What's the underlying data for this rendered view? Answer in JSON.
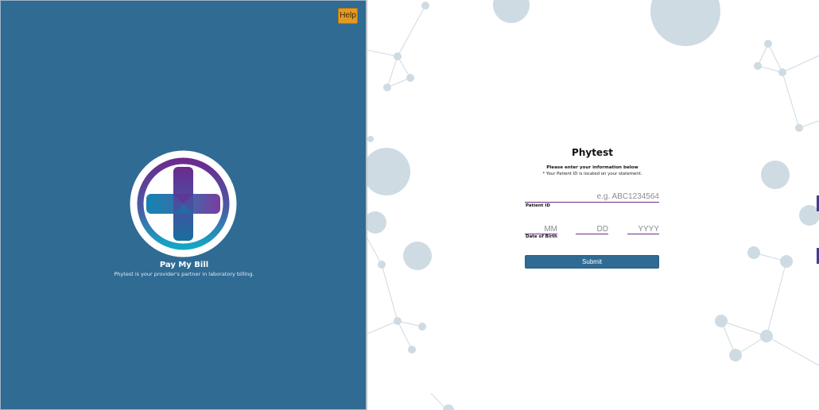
{
  "help": {
    "label": "Help"
  },
  "brand": {
    "title": "Pay My Bill",
    "tagline": "Phytest is your provider's partner in laboratory billing."
  },
  "form": {
    "title": "Phytest",
    "instruction": "Please enter your information below",
    "note": "* Your Patient ID is located on your statement.",
    "patient_id": {
      "value": "",
      "placeholder": "e.g. ABC1234564",
      "label": "Patient ID"
    },
    "dob": {
      "label": "Date of Birth",
      "month_placeholder": "MM",
      "day_placeholder": "DD",
      "year_placeholder": "YYYY"
    },
    "submit_label": "Submit"
  },
  "colors": {
    "brand_blue": "#2f6b93",
    "accent_purple": "#6a2c8c",
    "help_orange": "#e39a22",
    "molecule_gray": "#cfdbe3"
  }
}
